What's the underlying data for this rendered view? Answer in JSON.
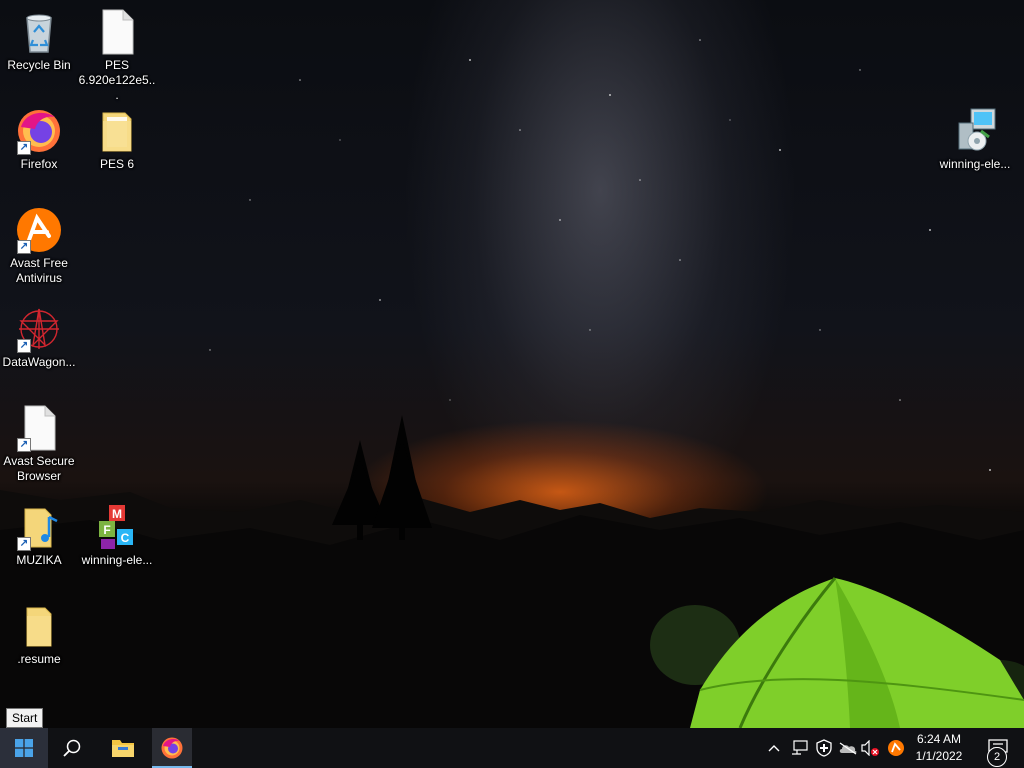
{
  "desktop": {
    "icons": [
      {
        "label": "Recycle Bin",
        "icon": "recycle-bin-icon"
      },
      {
        "label": "PES 6.920e122e5...",
        "icon": "file-icon"
      },
      {
        "label": "Firefox",
        "icon": "firefox-icon"
      },
      {
        "label": "PES 6",
        "icon": "folder-icon"
      },
      {
        "label": "Avast Free Antivirus",
        "icon": "avast-icon"
      },
      {
        "label": "DataWagon...",
        "icon": "datawagon-icon"
      },
      {
        "label": "Avast Secure Browser",
        "icon": "file-icon"
      },
      {
        "label": "MUZIKA",
        "icon": "music-folder-icon"
      },
      {
        "label": "winning-ele...",
        "icon": "winrar-archive-icon"
      },
      {
        "label": ".resume",
        "icon": "folder-icon"
      },
      {
        "label": "winning-ele...",
        "icon": "installer-icon"
      }
    ]
  },
  "tooltip": {
    "text": "Start"
  },
  "taskbar": {
    "start": "start-icon",
    "search": "search-icon",
    "pinned": [
      "file-explorer-icon",
      "firefox-icon"
    ],
    "tray_icons": [
      "chevron-up-icon",
      "network-icon",
      "defender-icon",
      "onedrive-offline-icon",
      "volume-muted-icon",
      "avast-tray-icon"
    ],
    "clock": {
      "time": "6:24 AM",
      "date": "1/1/2022"
    },
    "notifications": {
      "count": "2"
    }
  }
}
